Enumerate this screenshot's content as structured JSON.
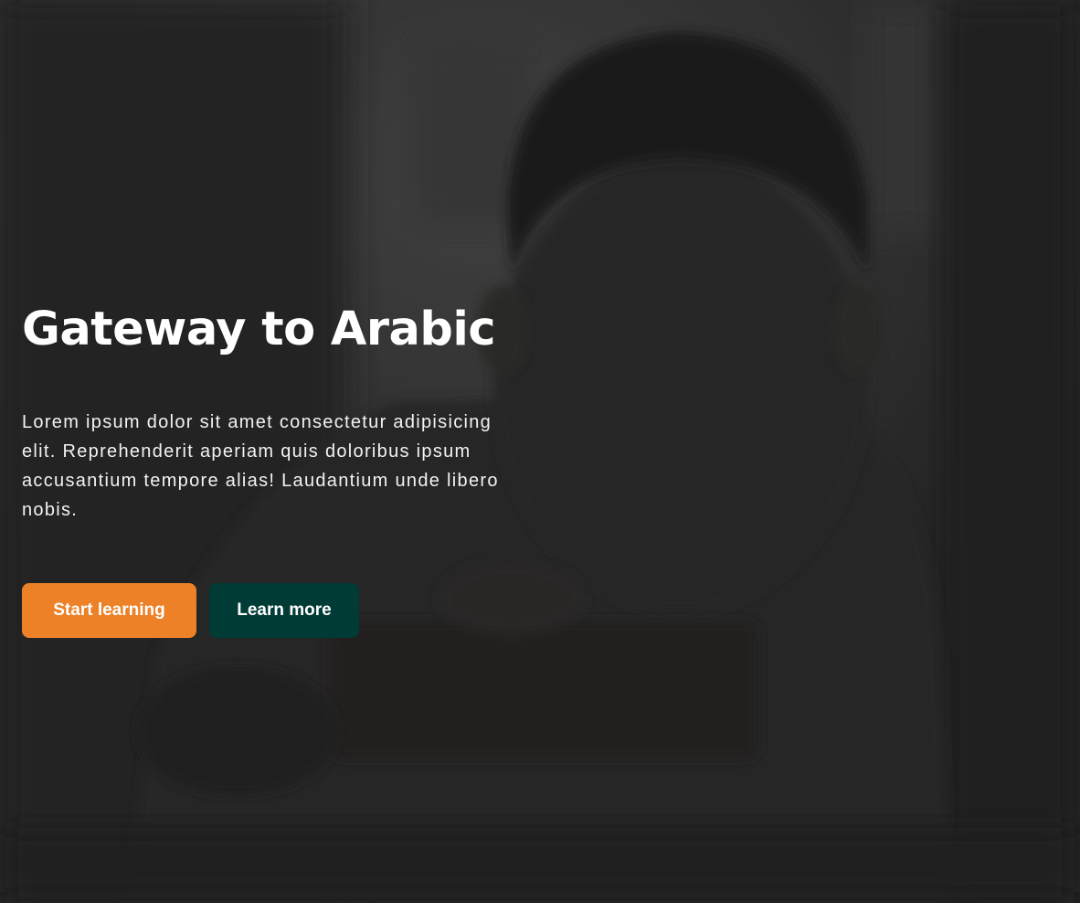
{
  "hero": {
    "title": "Gateway to Arabic",
    "text": "Lorem ipsum dolor sit amet consectetur adipisicing elit. Reprehenderit aperiam quis doloribus ipsum accusantium tempore alias! Laudantium unde libero nobis.",
    "primary_button": "Start learning",
    "secondary_button": "Learn more"
  },
  "colors": {
    "primary": "#ec8127",
    "secondary": "#003b36",
    "text": "#ffffff"
  }
}
